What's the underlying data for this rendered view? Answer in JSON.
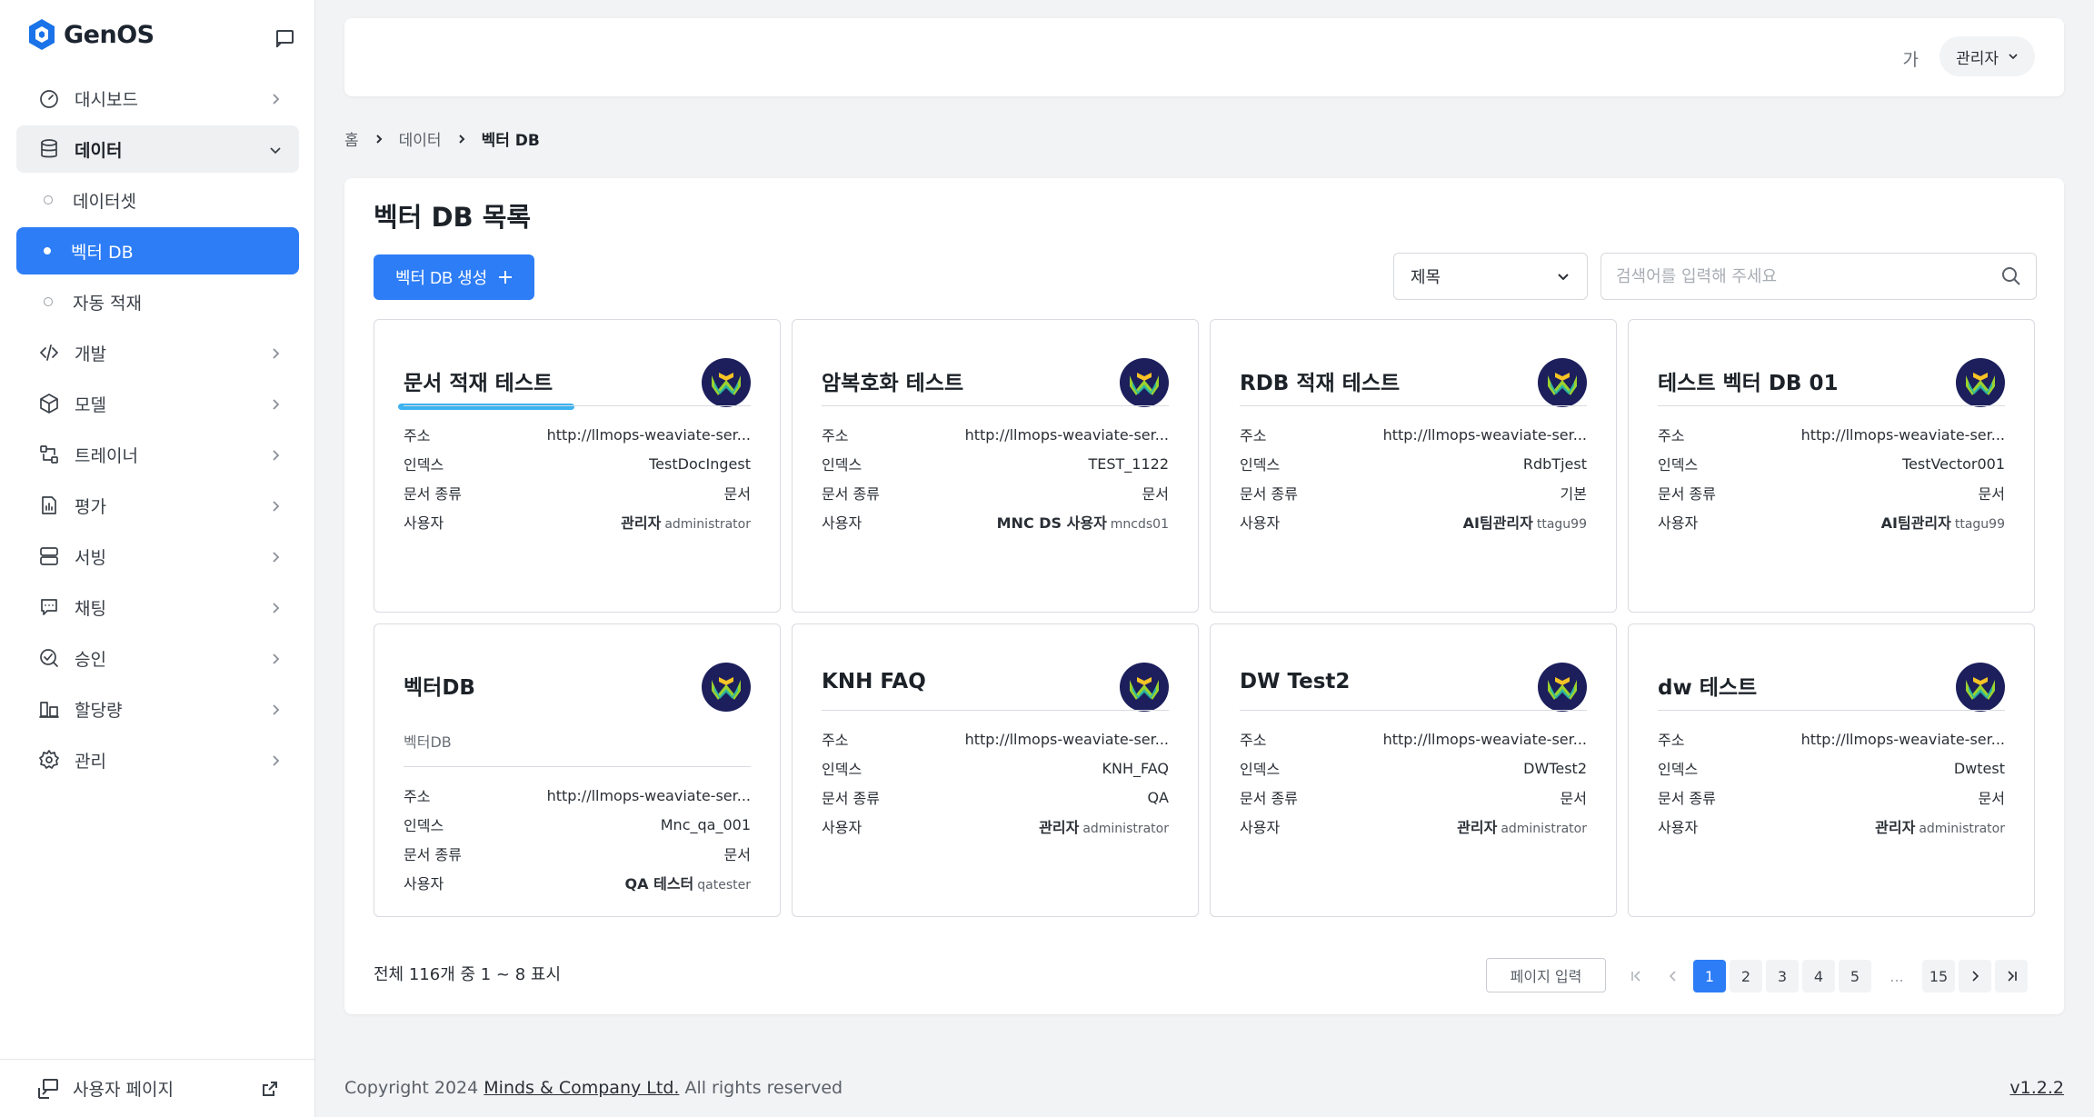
{
  "app": {
    "name": "GenOS"
  },
  "sidebar": {
    "items": [
      {
        "label": "대시보드",
        "icon": "gauge-icon"
      },
      {
        "label": "데이터",
        "icon": "database-icon",
        "open": true,
        "children": [
          {
            "label": "데이터셋",
            "active": false
          },
          {
            "label": "벡터 DB",
            "active": true
          },
          {
            "label": "자동 적재",
            "active": false
          }
        ]
      },
      {
        "label": "개발",
        "icon": "code-icon"
      },
      {
        "label": "모델",
        "icon": "cube-icon"
      },
      {
        "label": "트레이너",
        "icon": "trainer-icon"
      },
      {
        "label": "평가",
        "icon": "report-icon"
      },
      {
        "label": "서빙",
        "icon": "server-icon"
      },
      {
        "label": "채팅",
        "icon": "chat-icon"
      },
      {
        "label": "승인",
        "icon": "approval-icon"
      },
      {
        "label": "할당량",
        "icon": "quota-icon"
      },
      {
        "label": "관리",
        "icon": "gear-icon"
      }
    ],
    "footer_label": "사용자 페이지"
  },
  "header": {
    "lang_label": "가",
    "user_label": "관리자"
  },
  "breadcrumb": {
    "home": "홈",
    "parent": "데이터",
    "current": "벡터 DB"
  },
  "main": {
    "title": "벡터 DB 목록",
    "create_label": "벡터 DB 생성",
    "filter_selected": "제목",
    "search_placeholder": "검색어를 입력해 주세요",
    "field_labels": {
      "address": "주소",
      "index": "인덱스",
      "doc_type": "문서 종류",
      "user": "사용자"
    },
    "cards": [
      {
        "title": "문서 적재 테스트",
        "description": "",
        "address": "http://llmops-weaviate-ser...",
        "index": "TestDocIngest",
        "doc_type": "문서",
        "user_name": "관리자",
        "user_id": "administrator"
      },
      {
        "title": "암복호화 테스트",
        "description": "",
        "address": "http://llmops-weaviate-ser...",
        "index": "TEST_1122",
        "doc_type": "문서",
        "user_name": "MNC DS 사용자",
        "user_id": "mncds01"
      },
      {
        "title": "RDB 적재 테스트",
        "description": "",
        "address": "http://llmops-weaviate-ser...",
        "index": "RdbTjest",
        "doc_type": "기본",
        "user_name": "AI팀관리자",
        "user_id": "ttagu99"
      },
      {
        "title": "테스트 벡터 DB 01",
        "description": "",
        "address": "http://llmops-weaviate-ser...",
        "index": "TestVector001",
        "doc_type": "문서",
        "user_name": "AI팀관리자",
        "user_id": "ttagu99"
      },
      {
        "title": "벡터DB",
        "description": "벡터DB",
        "address": "http://llmops-weaviate-ser...",
        "index": "Mnc_qa_001",
        "doc_type": "문서",
        "user_name": "QA 테스터",
        "user_id": "qatester"
      },
      {
        "title": "KNH FAQ",
        "description": "",
        "address": "http://llmops-weaviate-ser...",
        "index": "KNH_FAQ",
        "doc_type": "QA",
        "user_name": "관리자",
        "user_id": "administrator"
      },
      {
        "title": "DW Test2",
        "description": "",
        "address": "http://llmops-weaviate-ser...",
        "index": "DWTest2",
        "doc_type": "문서",
        "user_name": "관리자",
        "user_id": "administrator"
      },
      {
        "title": "dw 테스트",
        "description": "",
        "address": "http://llmops-weaviate-ser...",
        "index": "Dwtest",
        "doc_type": "문서",
        "user_name": "관리자",
        "user_id": "administrator"
      }
    ]
  },
  "pagination": {
    "summary": "전체 116개 중 1 ~ 8 표시",
    "page_input_label": "페이지 입력",
    "pages": [
      "1",
      "2",
      "3",
      "4",
      "5"
    ],
    "current_page": "1",
    "ellipsis": "...",
    "last_page": "15"
  },
  "footer": {
    "copyright_prefix": "Copyright 2024 ",
    "company": "Minds & Company Ltd.",
    "copyright_suffix": " All rights reserved",
    "version": "v1.2.2"
  },
  "colors": {
    "accent": "#2d7df6",
    "highlight": "#3db2f0"
  }
}
